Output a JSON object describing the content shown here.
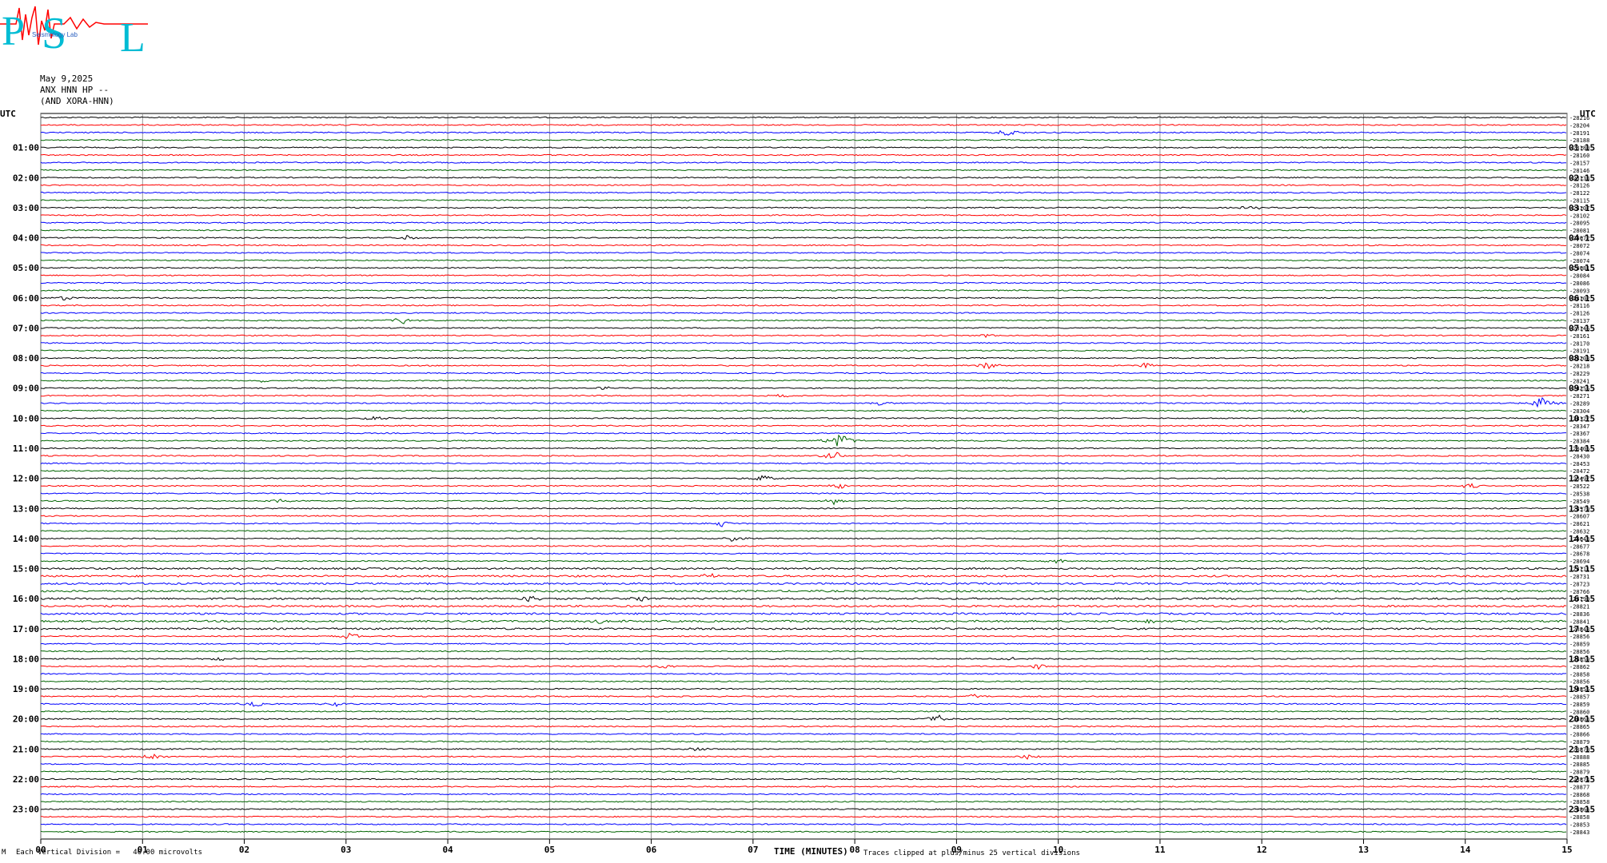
{
  "logo": {
    "text_p": "P",
    "text_s": "S",
    "text_l": "L",
    "subtitle": "Seismology Lab"
  },
  "header": {
    "date": "May 9,2025",
    "channel": "ANX HNN HP --",
    "network": "(AND XORA-HNN)"
  },
  "utc_label_left": "UTC",
  "utc_label_right": "UTC",
  "footer": {
    "division": "Each Vertical Division =   40.00 microvolts",
    "xlabel": "TIME (MINUTES)",
    "clip_note": "Traces clipped at plus/minus 25 vertical divisions",
    "corner": "M"
  },
  "colors": {
    "black": "#000000",
    "red": "#ff0000",
    "blue": "#0000ff",
    "green": "#006400",
    "grid": "#808080"
  },
  "chart_data": {
    "type": "line",
    "title": "",
    "xlabel": "TIME (MINUTES)",
    "ylabel": "",
    "xlim": [
      0,
      15
    ],
    "x_ticks": [
      "00",
      "01",
      "02",
      "03",
      "04",
      "05",
      "06",
      "07",
      "08",
      "09",
      "10",
      "11",
      "12",
      "13",
      "14",
      "15"
    ],
    "left_hour_labels": [
      "01:00",
      "02:00",
      "03:00",
      "04:00",
      "05:00",
      "06:00",
      "07:00",
      "08:00",
      "09:00",
      "10:00",
      "11:00",
      "12:00",
      "13:00",
      "14:00",
      "15:00",
      "16:00",
      "17:00",
      "18:00",
      "19:00",
      "20:00",
      "21:00",
      "22:00",
      "23:00"
    ],
    "right_hour_labels": [
      "01:15",
      "02:15",
      "03:15",
      "04:15",
      "05:15",
      "06:15",
      "07:15",
      "08:15",
      "09:15",
      "10:15",
      "11:15",
      "12:15",
      "13:15",
      "14:15",
      "15:15",
      "16:15",
      "17:15",
      "18:15",
      "19:15",
      "20:15",
      "21:15",
      "22:15",
      "23:15"
    ],
    "trace_colors_cycle": [
      "black",
      "red",
      "blue",
      "green"
    ],
    "trace_count": 96,
    "right_values": [
      "-28216",
      "-28204",
      "-28191",
      "-28188",
      "-28180",
      "-28160",
      "-28157",
      "-28146",
      "-28133",
      "-28126",
      "-28122",
      "-28115",
      "-28107",
      "-28102",
      "-28095",
      "-28081",
      "-28072",
      "-28072",
      "-28074",
      "-28074",
      "-28081",
      "-28084",
      "-28086",
      "-28093",
      "-28102",
      "-28116",
      "-28126",
      "-28137",
      "-28146",
      "-28161",
      "-28170",
      "-28191",
      "-28203",
      "-28218",
      "-28229",
      "-28241",
      "-28255",
      "-28271",
      "-28289",
      "-28304",
      "-28327",
      "-28347",
      "-28367",
      "-28384",
      "-28405",
      "-28430",
      "-28453",
      "-28472",
      "-28497",
      "-28522",
      "-28538",
      "-28549",
      "-28579",
      "-28607",
      "-28621",
      "-28632",
      "-28643",
      "-28677",
      "-28678",
      "-28694",
      "-28711",
      "-28731",
      "-28723",
      "-28766",
      "-28799",
      "-28821",
      "-28836",
      "-28841",
      "-28848",
      "-28856",
      "-28859",
      "-28856",
      "-28859",
      "-28862",
      "-28858",
      "-28856",
      "-28855",
      "-28857",
      "-28859",
      "-28860",
      "-28863",
      "-28865",
      "-28866",
      "-28879",
      "-28870",
      "-28888",
      "-28885",
      "-28879",
      "-28874",
      "-28877",
      "-28868",
      "-28858",
      "-28864",
      "-28858",
      "-28853",
      "-28843"
    ],
    "events": [
      {
        "trace": 2,
        "minute": 9.5,
        "amp": 7
      },
      {
        "trace": 12,
        "minute": 11.9,
        "amp": 3
      },
      {
        "trace": 16,
        "minute": 3.6,
        "amp": 3
      },
      {
        "trace": 24,
        "minute": 0.25,
        "amp": 4
      },
      {
        "trace": 27,
        "minute": 3.55,
        "amp": 5
      },
      {
        "trace": 29,
        "minute": 9.3,
        "amp": 3
      },
      {
        "trace": 33,
        "minute": 9.3,
        "amp": 6
      },
      {
        "trace": 33,
        "minute": 10.85,
        "amp": 4
      },
      {
        "trace": 35,
        "minute": 2.2,
        "amp": 3
      },
      {
        "trace": 36,
        "minute": 5.55,
        "amp": 3
      },
      {
        "trace": 37,
        "minute": 7.3,
        "amp": 3
      },
      {
        "trace": 38,
        "minute": 8.25,
        "amp": 3
      },
      {
        "trace": 38,
        "minute": 14.75,
        "amp": 9
      },
      {
        "trace": 39,
        "minute": 12.4,
        "amp": 3
      },
      {
        "trace": 40,
        "minute": 3.25,
        "amp": 5
      },
      {
        "trace": 43,
        "minute": 7.85,
        "amp": 14
      },
      {
        "trace": 45,
        "minute": 7.8,
        "amp": 6
      },
      {
        "trace": 48,
        "minute": 7.1,
        "amp": 5
      },
      {
        "trace": 49,
        "minute": 7.85,
        "amp": 4
      },
      {
        "trace": 49,
        "minute": 14.05,
        "amp": 4
      },
      {
        "trace": 51,
        "minute": 7.8,
        "amp": 5
      },
      {
        "trace": 51,
        "minute": 2.35,
        "amp": 3
      },
      {
        "trace": 54,
        "minute": 6.7,
        "amp": 4
      },
      {
        "trace": 56,
        "minute": 6.8,
        "amp": 5
      },
      {
        "trace": 61,
        "minute": 6.6,
        "amp": 4
      },
      {
        "trace": 64,
        "minute": 4.8,
        "amp": 5
      },
      {
        "trace": 64,
        "minute": 5.9,
        "amp": 4
      },
      {
        "trace": 67,
        "minute": 5.5,
        "amp": 4
      },
      {
        "trace": 69,
        "minute": 3.05,
        "amp": 5
      },
      {
        "trace": 72,
        "minute": 1.75,
        "amp": 3
      },
      {
        "trace": 72,
        "minute": 9.55,
        "amp": 3
      },
      {
        "trace": 73,
        "minute": 6.1,
        "amp": 3
      },
      {
        "trace": 73,
        "minute": 9.8,
        "amp": 4
      },
      {
        "trace": 77,
        "minute": 9.15,
        "amp": 4
      },
      {
        "trace": 78,
        "minute": 2.1,
        "amp": 4
      },
      {
        "trace": 78,
        "minute": 2.9,
        "amp": 3
      },
      {
        "trace": 80,
        "minute": 8.8,
        "amp": 7
      },
      {
        "trace": 84,
        "minute": 6.45,
        "amp": 3
      },
      {
        "trace": 85,
        "minute": 1.1,
        "amp": 5
      },
      {
        "trace": 85,
        "minute": 9.7,
        "amp": 4
      },
      {
        "trace": 67,
        "minute": 10.9,
        "amp": 3
      },
      {
        "trace": 59,
        "minute": 10.0,
        "amp": 3
      }
    ],
    "grid": true
  }
}
